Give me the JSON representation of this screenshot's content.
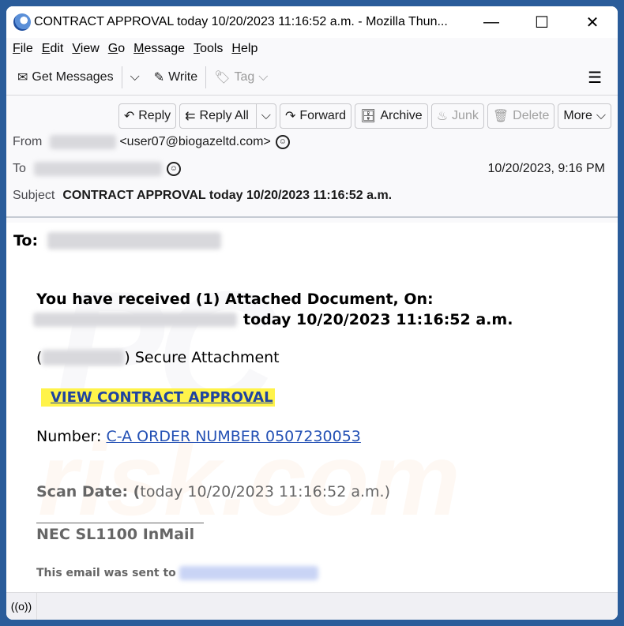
{
  "window": {
    "title": "CONTRACT APPROVAL today 10/20/2023 11:16:52 a.m. - Mozilla Thun...",
    "controls": {
      "minimize": "—",
      "maximize": "☐",
      "close": "✕"
    }
  },
  "menubar": {
    "items": [
      {
        "key": "F",
        "rest": "ile"
      },
      {
        "key": "E",
        "rest": "dit"
      },
      {
        "key": "V",
        "rest": "iew"
      },
      {
        "key": "G",
        "rest": "o"
      },
      {
        "key": "M",
        "rest": "essage"
      },
      {
        "key": "T",
        "rest": "ools"
      },
      {
        "key": "H",
        "rest": "elp"
      }
    ]
  },
  "toolbar": {
    "get_messages": "Get Messages",
    "write": "Write",
    "tag": "Tag"
  },
  "actions": {
    "reply": "Reply",
    "reply_all": "Reply All",
    "forward": "Forward",
    "archive": "Archive",
    "junk": "Junk",
    "delete": "Delete",
    "more": "More"
  },
  "header": {
    "from_label": "From",
    "from_email": "<user07@biogazeltd.com>",
    "to_label": "To",
    "date": "10/20/2023, 9:16 PM",
    "subject_label": "Subject",
    "subject": "CONTRACT APPROVAL today 10/20/2023 11:16:52 a.m."
  },
  "body": {
    "to_label": "To:",
    "headline_line1": "You have received (1) Attached Document, On:",
    "headline_line2": "today 10/20/2023 11:16:52 a.m.",
    "secure_open": "(",
    "secure_text": ") Secure Attachment",
    "view_link": "VIEW CONTRACT APPROVAL",
    "number_label": "Number: ",
    "number_link": "C-A ORDER NUMBER 0507230053",
    "scan_label": "Scan Date: (",
    "scan_value": "today 10/20/2023 11:16:52 a.m.)",
    "signature": "NEC SL1100 InMail",
    "sent_to": "This email was sent to"
  },
  "watermark": {
    "line1": "PC",
    "line2": "risk.com"
  },
  "statusbar": {
    "icon": "((o))"
  }
}
